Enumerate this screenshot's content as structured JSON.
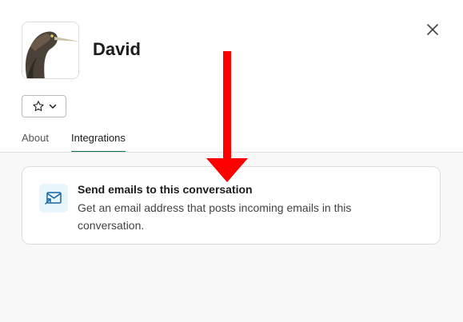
{
  "profile": {
    "name": "David",
    "avatar_icon": "heron-photo-icon"
  },
  "header": {
    "close_icon": "close-icon",
    "star_icon": "star-icon",
    "chevron_icon": "chevron-down-icon"
  },
  "tabs": [
    {
      "label": "About",
      "active": false
    },
    {
      "label": "Integrations",
      "active": true
    }
  ],
  "integrations": {
    "email_card": {
      "icon": "email-forward-icon",
      "title": "Send emails to this conversation",
      "description": "Get an email address that posts incoming emails in this conversation."
    }
  },
  "colors": {
    "tab_underline": "#1b6e5a",
    "annotation_arrow": "#ff0000",
    "icon_bg": "#e8f5fa",
    "icon_stroke": "#1264a3"
  }
}
